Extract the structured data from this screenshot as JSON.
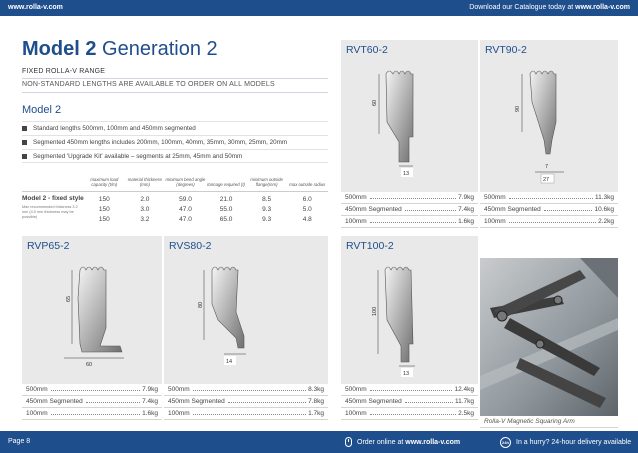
{
  "header": {
    "url": "www.rolla-v.com",
    "download_prefix": "Download our Catalogue today at ",
    "download_url": "www.rolla-v.com"
  },
  "title": {
    "bold": "Model 2",
    "light": "Generation 2"
  },
  "subtitle": "FIXED ROLLA-V RANGE",
  "subtitle2": "NON-STANDARD LENGTHS ARE AVAILABLE TO ORDER ON ALL MODELS",
  "model_heading": "Model 2",
  "bullets": [
    "Standard lengths 500mm, 100mm and 450mm segmented",
    "Segmented 450mm lengths includes 200mm, 100mm, 40mm, 35mm, 30mm, 25mm, 20mm",
    "Segmented 'Upgrade Kit' available – segments at 25mm, 45mm and 50mm"
  ],
  "spec_table": {
    "headers": [
      "maximum load capacity (t/m)",
      "material thickness (mm)",
      "minimum bend angle (degrees)",
      "tonnage required (t)",
      "minimum outside flange(mm)",
      "max outside radius"
    ],
    "row_name": "Model 2 - fixed style",
    "row_note": "Max recommended thickness 3.2 mm (4.0 mm thickness may be possible)",
    "columns": [
      [
        "150",
        "150",
        "150"
      ],
      [
        "2.0",
        "3.0",
        "3.2"
      ],
      [
        "59.0",
        "47.0",
        "47.0"
      ],
      [
        "21.0",
        "55.0",
        "65.0"
      ],
      [
        "8.5",
        "9.3",
        "9.3"
      ],
      [
        "6.0",
        "5.0",
        "4.8"
      ]
    ]
  },
  "cards": {
    "rvt60": {
      "title": "RVT60-2",
      "dim_h": "60",
      "dim_w": "13",
      "rows": [
        {
          "label": "500mm",
          "value": "7.9kg"
        },
        {
          "label": "450mm Segmented",
          "value": "7.4kg"
        },
        {
          "label": "100mm",
          "value": "1.6kg"
        }
      ]
    },
    "rvt90": {
      "title": "RVT90-2",
      "dim_h": "90",
      "dim_tip": "7",
      "dim_w": "27",
      "rows": [
        {
          "label": "500mm",
          "value": "11.3kg"
        },
        {
          "label": "450mm Segmented",
          "value": "10.6kg"
        },
        {
          "label": "100mm",
          "value": "2.2kg"
        }
      ]
    },
    "rvp65": {
      "title": "RVP65-2",
      "dim_h": "65",
      "dim_w": "60",
      "rows": [
        {
          "label": "500mm",
          "value": "7.9kg"
        },
        {
          "label": "450mm Segmented",
          "value": "7.4kg"
        },
        {
          "label": "100mm",
          "value": "1.6kg"
        }
      ]
    },
    "rvs80": {
      "title": "RVS80-2",
      "dim_h": "80",
      "dim_w": "14",
      "rows": [
        {
          "label": "500mm",
          "value": "8.3kg"
        },
        {
          "label": "450mm Segmented",
          "value": "7.8kg"
        },
        {
          "label": "100mm",
          "value": "1.7kg"
        }
      ]
    },
    "rvt100": {
      "title": "RVT100-2",
      "dim_h": "100",
      "dim_w": "13",
      "rows": [
        {
          "label": "500mm",
          "value": "12.4kg"
        },
        {
          "label": "450mm Segmented",
          "value": "11.7kg"
        },
        {
          "label": "100mm",
          "value": "2.5kg"
        }
      ]
    }
  },
  "photo_caption": "Rolla-V Magnetic Squaring Arm",
  "footer": {
    "page": "Page 8",
    "order_prefix": "Order online at ",
    "order_url": "www.rolla-v.com",
    "hurry": "In a hurry? 24-hour delivery available",
    "clock_label": "24h"
  }
}
